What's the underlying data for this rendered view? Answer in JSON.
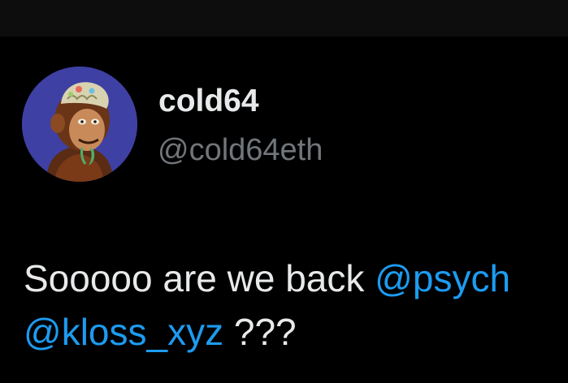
{
  "top_bar": {
    "glyph": "'"
  },
  "author": {
    "display_name": "cold64",
    "handle": "@cold64eth",
    "avatar_icon": "ape-avatar-icon"
  },
  "tweet": {
    "line1_text": "Sooooo are we back ",
    "line1_mention": "@psych",
    "line2_mention": "@kloss_xyz",
    "line2_text": " ???"
  },
  "colors": {
    "background": "#000000",
    "text": "#e7e9ea",
    "muted": "#71767b",
    "mention": "#1d9bf0",
    "avatar_bg": "#3f40a3"
  }
}
